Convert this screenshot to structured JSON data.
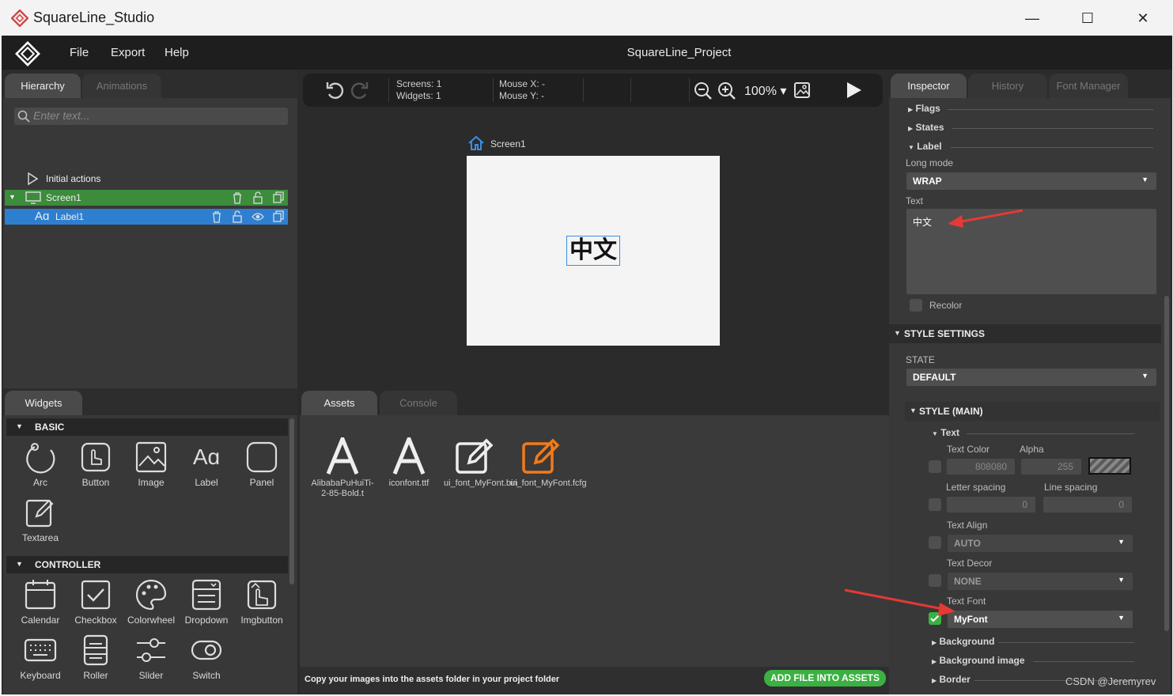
{
  "window": {
    "title": "SquareLine_Studio",
    "minimize": "—",
    "maximize": "☐",
    "close": "✕"
  },
  "menu": {
    "items": [
      "File",
      "Export",
      "Help"
    ],
    "project_name": "SquareLine_Project"
  },
  "hierarchy": {
    "tabs": [
      "Hierarchy",
      "Animations"
    ],
    "search_placeholder": "Enter text...",
    "initial_actions": "Initial actions",
    "screen_item": "Screen1",
    "label_item": "Label1"
  },
  "widgets_panel": {
    "tab": "Widgets",
    "categories": [
      {
        "name": "BASIC",
        "items": [
          "Arc",
          "Button",
          "Image",
          "Label",
          "Panel",
          "Textarea"
        ]
      },
      {
        "name": "CONTROLLER",
        "items": [
          "Calendar",
          "Checkbox",
          "Colorwheel",
          "Dropdown",
          "Imgbutton",
          "Keyboard",
          "Roller",
          "Slider",
          "Switch"
        ]
      }
    ]
  },
  "toolbar": {
    "screens_label": "Screens:",
    "screens_value": "1",
    "widgets_label": "Widgets:",
    "widgets_value": "1",
    "mouse_x_label": "Mouse X:",
    "mouse_x_value": "-",
    "mouse_y_label": "Mouse Y:",
    "mouse_y_value": "-",
    "zoom": "100%"
  },
  "canvas": {
    "screen_name": "Screen1",
    "label_text": "中文"
  },
  "assets_panel": {
    "tabs": [
      "Assets",
      "Console"
    ],
    "files": [
      {
        "name": "AlibabaPuHuiTi-2-85-Bold.t",
        "kind": "font"
      },
      {
        "name": "iconfont.ttf",
        "kind": "font"
      },
      {
        "name": "ui_font_MyFont.bin",
        "kind": "edit"
      },
      {
        "name": "ui_font_MyFont.fcfg",
        "kind": "edit-orange"
      }
    ],
    "hint": "Copy your images into the assets folder in your project folder",
    "add_button": "ADD FILE INTO ASSETS"
  },
  "inspector": {
    "tabs": [
      "Inspector",
      "History",
      "Font Manager"
    ],
    "sections": [
      "Flags",
      "States",
      "Label"
    ],
    "long_mode_label": "Long mode",
    "long_mode_value": "WRAP",
    "text_label": "Text",
    "text_value": "中文",
    "recolor_label": "Recolor",
    "style_settings": "STYLE SETTINGS",
    "state_label": "STATE",
    "state_value": "DEFAULT",
    "style_main": "STYLE (MAIN)",
    "text_group": "Text",
    "text_color_label": "Text Color",
    "text_color_value": "808080",
    "alpha_label": "Alpha",
    "alpha_value": "255",
    "letter_spacing_label": "Letter spacing",
    "letter_spacing_value": "0",
    "line_spacing_label": "Line spacing",
    "line_spacing_value": "0",
    "text_align_label": "Text Align",
    "text_align_value": "AUTO",
    "text_decor_label": "Text Decor",
    "text_decor_value": "NONE",
    "text_font_label": "Text Font",
    "text_font_value": "MyFont",
    "more_sections": [
      "Background",
      "Background image",
      "Border"
    ]
  },
  "watermark": "CSDN @Jeremyrev",
  "colors": {
    "screen_row": "#3c8c3c",
    "label_row": "#2f7fd0",
    "add_button": "#3cb043",
    "arrow_annotation": "#e53935"
  }
}
